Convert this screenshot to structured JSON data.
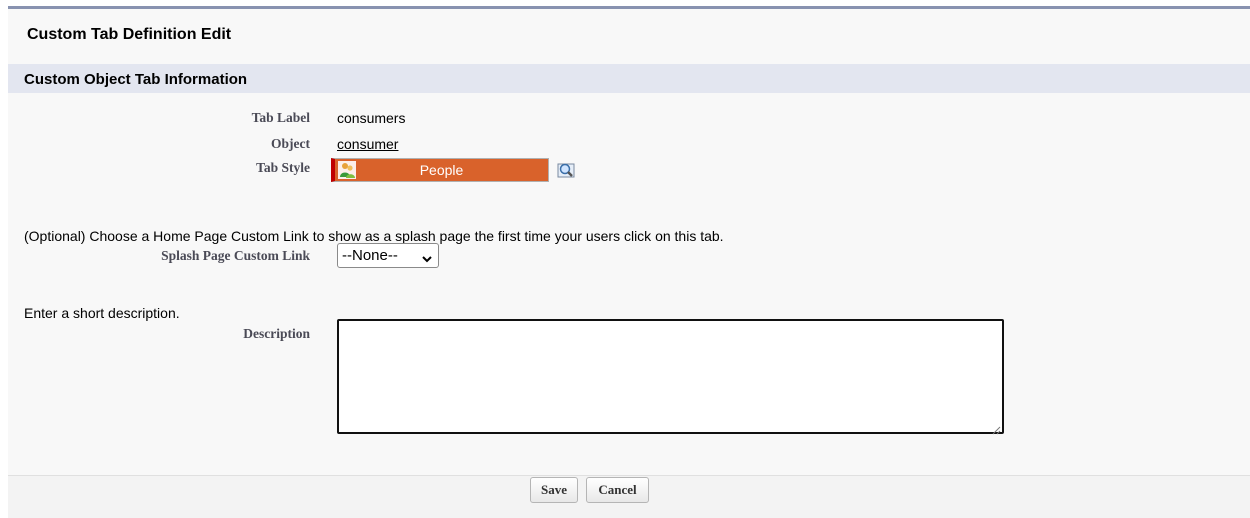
{
  "page": {
    "title": "Custom Tab Definition Edit"
  },
  "section": {
    "title": "Custom Object Tab Information"
  },
  "fields": {
    "tab_label": {
      "label": "Tab Label",
      "value": "consumers"
    },
    "object": {
      "label": "Object",
      "value": "consumer"
    },
    "tab_style": {
      "label": "Tab Style",
      "value": "People",
      "icon": "people-icon",
      "color": "#d9622b"
    }
  },
  "splash": {
    "help": "(Optional) Choose a Home Page Custom Link to show as a splash page the first time your users click on this tab.",
    "label": "Splash Page Custom Link",
    "selected": "--None--"
  },
  "description": {
    "help": "Enter a short description.",
    "label": "Description",
    "value": ""
  },
  "buttons": {
    "save": "Save",
    "cancel": "Cancel"
  }
}
